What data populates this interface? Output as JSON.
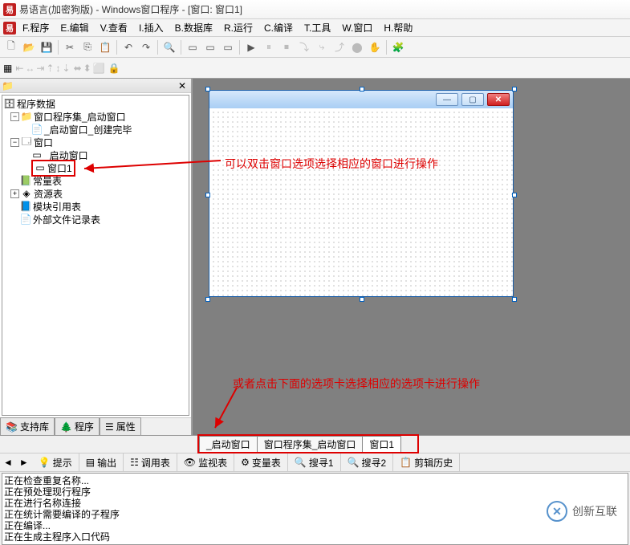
{
  "title": "易语言(加密狗版) - Windows窗口程序 - [窗口: 窗口1]",
  "menu": {
    "file": "F.程序",
    "edit": "E.编辑",
    "view": "V.查看",
    "insert": "I.插入",
    "database": "B.数据库",
    "run": "R.运行",
    "compile": "C.编译",
    "tools": "T.工具",
    "window": "W.窗口",
    "help": "H.帮助"
  },
  "tree": {
    "root": "程序数据",
    "n1": "窗口程序集_启动窗口",
    "n1a": "_启动窗口_创建完毕",
    "n2": "窗口",
    "n2a": "_启动窗口",
    "n2b": "窗口1",
    "n3": "常量表",
    "n4": "资源表",
    "n5": "模块引用表",
    "n6": "外部文件记录表"
  },
  "lefttabs": {
    "a": "支持库",
    "b": "程序",
    "c": "属性"
  },
  "bottabs": {
    "a": "_启动窗口",
    "b": "窗口程序集_启动窗口",
    "c": "窗口1"
  },
  "annot1": "可以双击窗口选项选择相应的窗口进行操作",
  "annot2": "或者点击下面的选项卡选择相应的选项卡进行操作",
  "outtabs": {
    "a": "提示",
    "b": "输出",
    "c": "调用表",
    "d": "监视表",
    "e": "变量表",
    "f": "搜寻1",
    "g": "搜寻2",
    "h": "剪辑历史"
  },
  "output": {
    "l1": "正在检查重复名称...",
    "l2": "正在预处理现行程序",
    "l3": "正在进行名称连接",
    "l4": "正在统计需要编译的子程序",
    "l5": "正在编译...",
    "l6": "正在生成主程序入口代码"
  },
  "watermark": "创新互联"
}
